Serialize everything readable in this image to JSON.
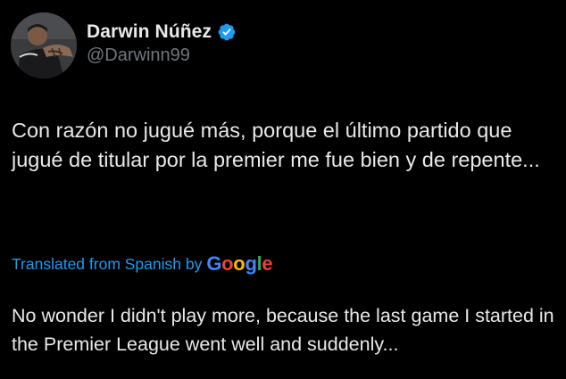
{
  "user": {
    "display_name": "Darwin Núñez",
    "handle": "@Darwinn99",
    "verified": true,
    "verified_color": "#1d9bf0"
  },
  "tweet": {
    "text": "Con razón no jugué más, porque el último partido que jugué de titular por la premier me fue bien y de repente..."
  },
  "translation": {
    "label": "Translated from Spanish by",
    "provider": "Google",
    "text": "No wonder I didn't play more, because the last game I started in the Premier League went well and suddenly..."
  },
  "colors": {
    "background": "#000000",
    "text_primary": "#e7e9ea",
    "text_secondary": "#71767b",
    "link": "#1d9bf0",
    "google_blue": "#4285f4",
    "google_red": "#ea4335",
    "google_yellow": "#fbbc05",
    "google_green": "#34a853"
  }
}
